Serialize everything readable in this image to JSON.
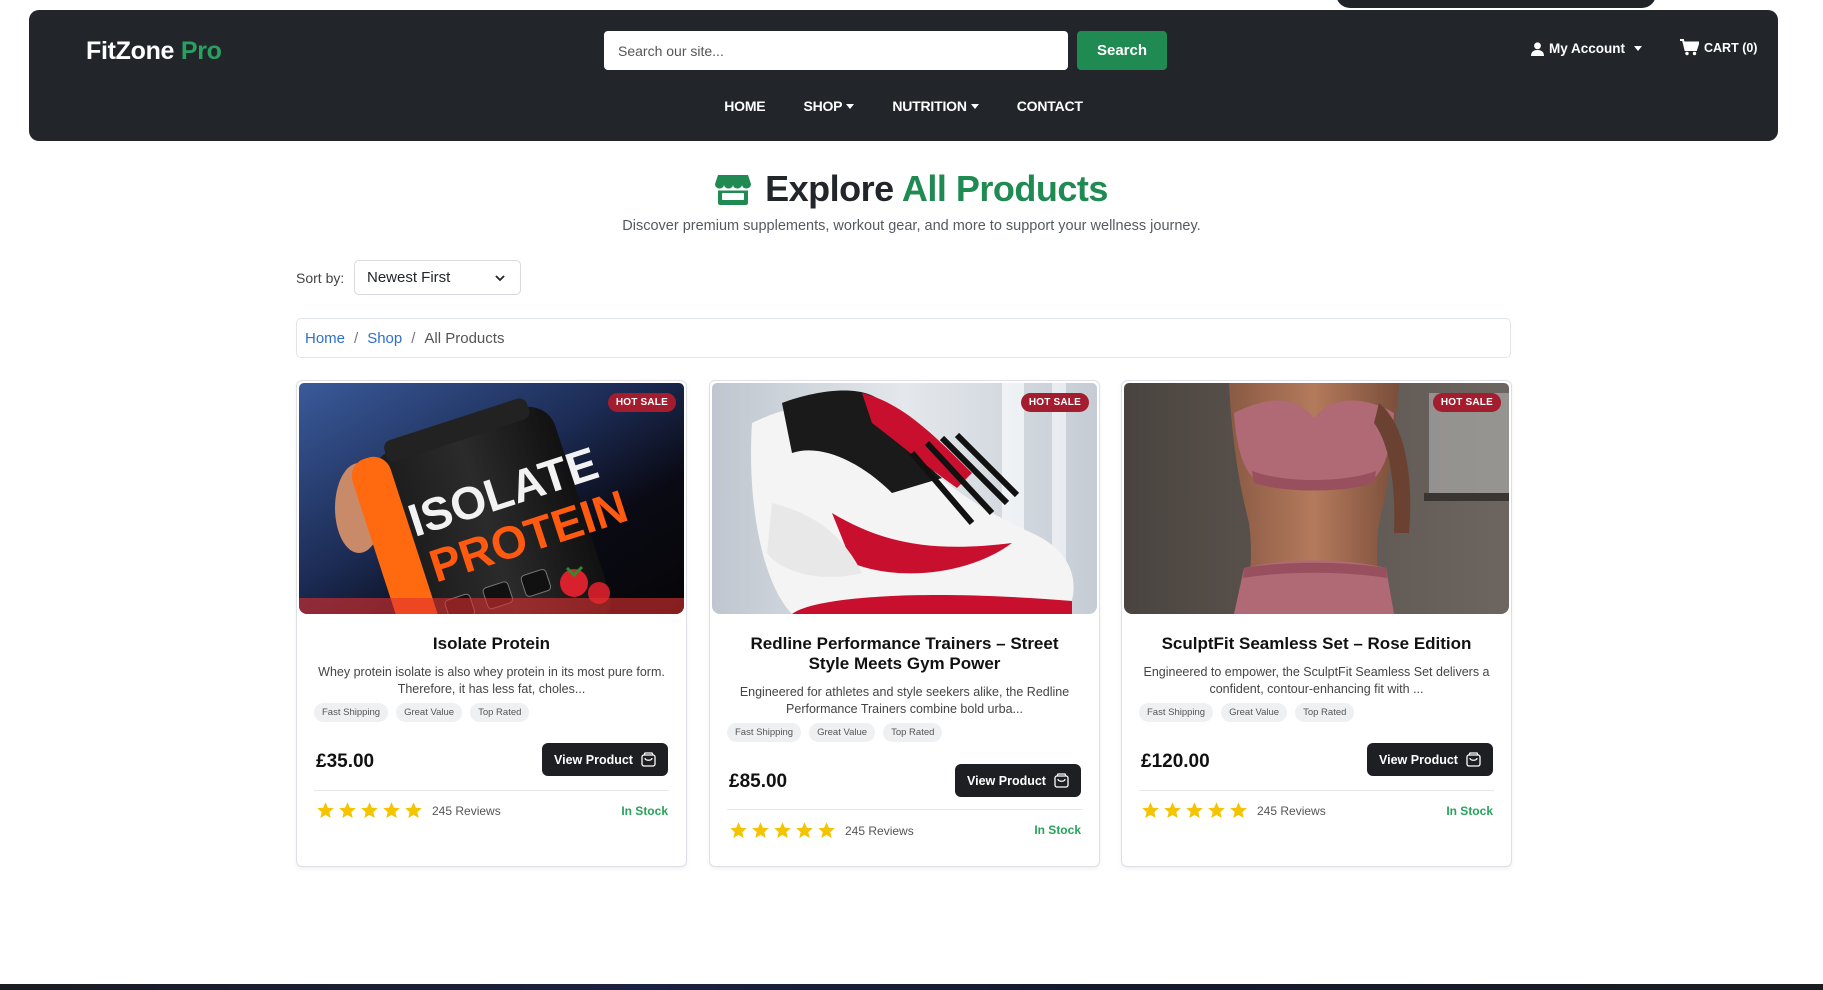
{
  "header": {
    "logo_main": "FitZone",
    "logo_accent": "Pro",
    "search_placeholder": "Search our site...",
    "search_button": "Search",
    "account_label": "My Account",
    "cart_label": "CART (0)",
    "nav": [
      {
        "label": "HOME"
      },
      {
        "label": "SHOP"
      },
      {
        "label": "NUTRITION"
      },
      {
        "label": "CONTACT"
      }
    ]
  },
  "page": {
    "title_main": "Explore",
    "title_accent": "All Products",
    "subtitle": "Discover premium supplements, workout gear, and more to support your wellness journey.",
    "sort_label": "Sort by:",
    "sort_value": "Newest First"
  },
  "breadcrumb": {
    "home": "Home",
    "shop": "Shop",
    "current": "All Products"
  },
  "products": [
    {
      "badge": "HOT SALE",
      "title": "Isolate Protein",
      "description": "Whey protein isolate is also whey protein in its most pure form. Therefore, it has less fat, choles...",
      "tags": [
        "Fast Shipping",
        "Great Value",
        "Top Rated"
      ],
      "price": "£35.00",
      "button": "View Product",
      "rating": 5,
      "reviews": "245 Reviews",
      "stock": "In Stock",
      "image_label": "ISOLATE PROTEIN"
    },
    {
      "badge": "HOT SALE",
      "title": "Redline Performance Trainers – Street Style Meets Gym Power",
      "description": "Engineered for athletes and style seekers alike, the Redline Performance Trainers combine bold urba...",
      "tags": [
        "Fast Shipping",
        "Great Value",
        "Top Rated"
      ],
      "price": "£85.00",
      "button": "View Product",
      "rating": 5,
      "reviews": "245 Reviews",
      "stock": "In Stock"
    },
    {
      "badge": "HOT SALE",
      "title": "SculptFit Seamless Set – Rose Edition",
      "description": "Engineered to empower, the SculptFit Seamless Set delivers a confident, contour-enhancing fit with ...",
      "tags": [
        "Fast Shipping",
        "Great Value",
        "Top Rated"
      ],
      "price": "£120.00",
      "button": "View Product",
      "rating": 5,
      "reviews": "245 Reviews",
      "stock": "In Stock"
    }
  ],
  "colors": {
    "header_bg": "#22262b",
    "brand_green": "#1f8a51",
    "badge_red": "#a31d2f",
    "star_yellow": "#f5c400",
    "stock_green": "#27a35a",
    "link_blue": "#2f6fce"
  }
}
